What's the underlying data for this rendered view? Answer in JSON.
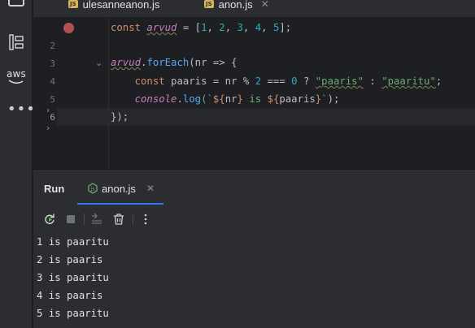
{
  "editor_tabs": [
    {
      "label": "ulesanneanon.js",
      "active": false
    },
    {
      "label": "anon.js",
      "active": true
    }
  ],
  "icons": {
    "aws_label": "aws",
    "more": "•••"
  },
  "code": {
    "line_numbers": [
      "1",
      "2",
      "3",
      "4",
      "5",
      "6"
    ],
    "lines": [
      [
        {
          "t": "const ",
          "c": "kw"
        },
        {
          "t": "arvud",
          "c": "var"
        },
        {
          "t": " = [",
          "c": "p"
        },
        {
          "t": "1",
          "c": "num"
        },
        {
          "t": ", ",
          "c": "p"
        },
        {
          "t": "2",
          "c": "num"
        },
        {
          "t": ", ",
          "c": "p"
        },
        {
          "t": "3",
          "c": "num"
        },
        {
          "t": ", ",
          "c": "p"
        },
        {
          "t": "4",
          "c": "num"
        },
        {
          "t": ", ",
          "c": "p"
        },
        {
          "t": "5",
          "c": "num"
        },
        {
          "t": "];",
          "c": "p"
        }
      ],
      [],
      [
        {
          "t": "arvud",
          "c": "var"
        },
        {
          "t": ".",
          "c": "p"
        },
        {
          "t": "forEach",
          "c": "fn"
        },
        {
          "t": "(nr => {",
          "c": "p"
        }
      ],
      [
        {
          "t": "    ",
          "c": "p"
        },
        {
          "t": "const ",
          "c": "kw"
        },
        {
          "t": "paaris = nr % ",
          "c": "p"
        },
        {
          "t": "2",
          "c": "num"
        },
        {
          "t": " === ",
          "c": "p"
        },
        {
          "t": "0",
          "c": "num"
        },
        {
          "t": " ? ",
          "c": "p"
        },
        {
          "t": "\"paaris\"",
          "c": "str-u"
        },
        {
          "t": " : ",
          "c": "p"
        },
        {
          "t": "\"paaritu\"",
          "c": "str-u"
        },
        {
          "t": ";",
          "c": "p"
        }
      ],
      [
        {
          "t": "    ",
          "c": "p"
        },
        {
          "t": "console",
          "c": "con"
        },
        {
          "t": ".",
          "c": "p"
        },
        {
          "t": "log",
          "c": "fn"
        },
        {
          "t": "(`",
          "c": "tmpl"
        },
        {
          "t": "${",
          "c": "kw"
        },
        {
          "t": "nr",
          "c": "p"
        },
        {
          "t": "}",
          "c": "kw"
        },
        {
          "t": " is ",
          "c": "tmpl"
        },
        {
          "t": "${",
          "c": "kw"
        },
        {
          "t": "paaris",
          "c": "p"
        },
        {
          "t": "}",
          "c": "kw"
        },
        {
          "t": "`",
          "c": "tmpl"
        },
        {
          "t": ");",
          "c": "p"
        }
      ],
      [
        {
          "t": "});",
          "c": "p"
        }
      ]
    ]
  },
  "run": {
    "title": "Run",
    "tab_label": "anon.js",
    "output": [
      "1 is paaritu",
      "2 is paaris",
      "3 is paaritu",
      "4 is paaris",
      "5 is paaritu"
    ]
  },
  "colors": {
    "accent": "#3574f0",
    "breakpoint": "#db5c5c"
  }
}
